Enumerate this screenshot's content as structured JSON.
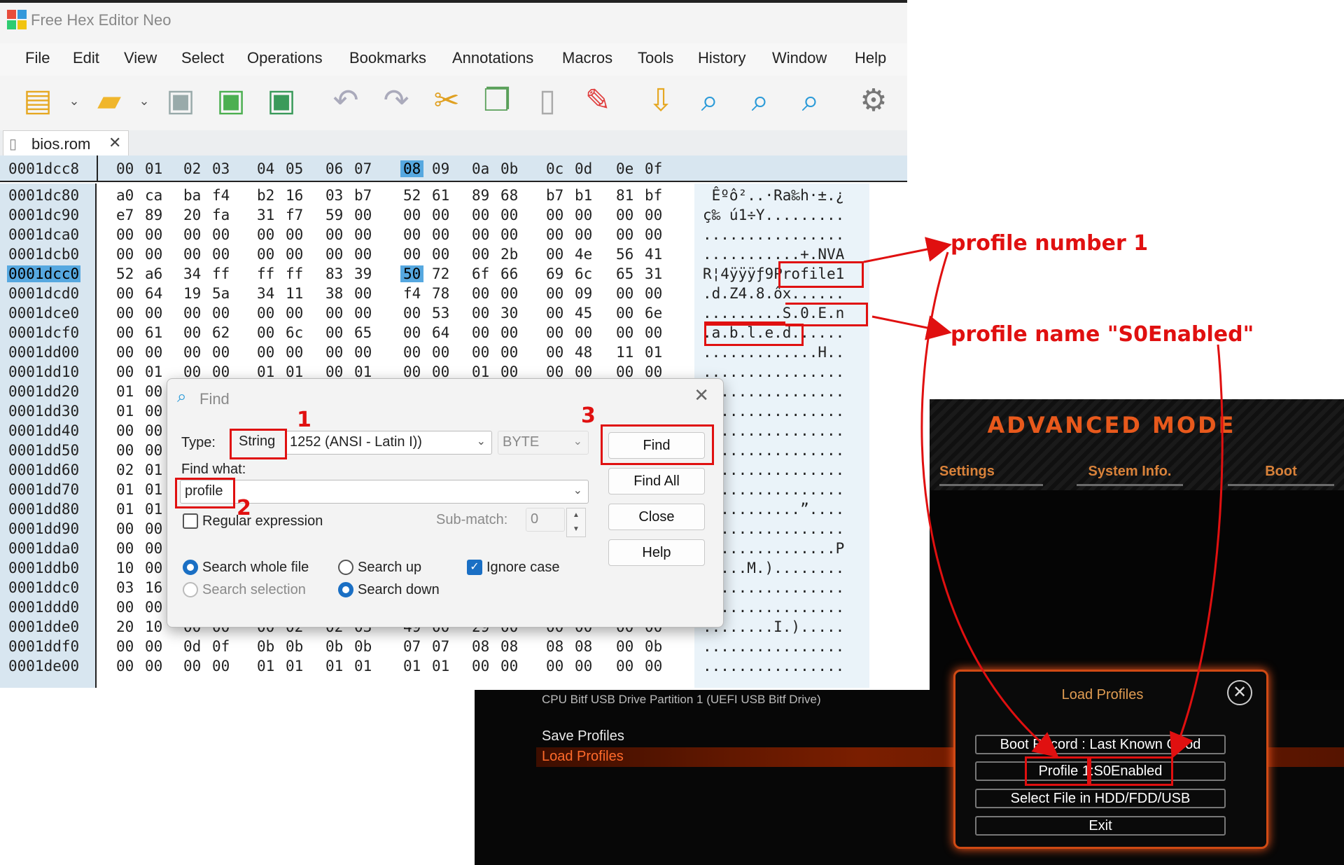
{
  "app": {
    "title": "Free Hex Editor Neo"
  },
  "menu": [
    "File",
    "Edit",
    "View",
    "Select",
    "Operations",
    "Bookmarks",
    "Annotations",
    "Macros",
    "Tools",
    "History",
    "Window",
    "Help"
  ],
  "toolbar_icons": [
    "new-file-icon",
    "open-folder-icon",
    "save-icon",
    "save-as-icon",
    "save-all-icon",
    "undo-icon",
    "redo-icon",
    "cut-icon",
    "copy-icon",
    "paste-icon",
    "modify-icon",
    "import-icon",
    "find-icon",
    "find-previous-icon",
    "find-next-icon",
    "settings-icon"
  ],
  "file_tab": {
    "name": "bios.rom",
    "close": "✕"
  },
  "hex": {
    "current_offset": "0001dcc8",
    "columns": [
      "00",
      "01",
      "02",
      "03",
      "04",
      "05",
      "06",
      "07",
      "08",
      "09",
      "0a",
      "0b",
      "0c",
      "0d",
      "0e",
      "0f"
    ],
    "rows": [
      {
        "addr": "0001dc80",
        "bytes": [
          "a0",
          "ca",
          "ba",
          "f4",
          "b2",
          "16",
          "03",
          "b7",
          "52",
          "61",
          "89",
          "68",
          "b7",
          "b1",
          "81",
          "bf"
        ],
        "ascii": " Êºô²..·Ra‰h·±.¿"
      },
      {
        "addr": "0001dc90",
        "bytes": [
          "e7",
          "89",
          "20",
          "fa",
          "31",
          "f7",
          "59",
          "00",
          "00",
          "00",
          "00",
          "00",
          "00",
          "00",
          "00",
          "00"
        ],
        "ascii": "ç‰ ú1÷Y........."
      },
      {
        "addr": "0001dca0",
        "bytes": [
          "00",
          "00",
          "00",
          "00",
          "00",
          "00",
          "00",
          "00",
          "00",
          "00",
          "00",
          "00",
          "00",
          "00",
          "00",
          "00"
        ],
        "ascii": "................"
      },
      {
        "addr": "0001dcb0",
        "bytes": [
          "00",
          "00",
          "00",
          "00",
          "00",
          "00",
          "00",
          "00",
          "00",
          "00",
          "00",
          "2b",
          "00",
          "4e",
          "56",
          "41"
        ],
        "ascii": "...........+.NVA"
      },
      {
        "addr": "0001dcc0",
        "bytes": [
          "52",
          "a6",
          "34",
          "ff",
          "ff",
          "ff",
          "83",
          "39",
          "50",
          "72",
          "6f",
          "66",
          "69",
          "6c",
          "65",
          "31"
        ],
        "ascii": "R¦4ÿÿÿƒ9Profile1"
      },
      {
        "addr": "0001dcd0",
        "bytes": [
          "00",
          "64",
          "19",
          "5a",
          "34",
          "11",
          "38",
          "00",
          "f4",
          "78",
          "00",
          "00",
          "00",
          "09",
          "00",
          "00"
        ],
        "ascii": ".d.Z4.8.ôx......"
      },
      {
        "addr": "0001dce0",
        "bytes": [
          "00",
          "00",
          "00",
          "00",
          "00",
          "00",
          "00",
          "00",
          "00",
          "53",
          "00",
          "30",
          "00",
          "45",
          "00",
          "6e"
        ],
        "ascii": ".........S.0.E.n"
      },
      {
        "addr": "0001dcf0",
        "bytes": [
          "00",
          "61",
          "00",
          "62",
          "00",
          "6c",
          "00",
          "65",
          "00",
          "64",
          "00",
          "00",
          "00",
          "00",
          "00",
          "00"
        ],
        "ascii": ".a.b.l.e.d......"
      },
      {
        "addr": "0001dd00",
        "bytes": [
          "00",
          "00",
          "00",
          "00",
          "00",
          "00",
          "00",
          "00",
          "00",
          "00",
          "00",
          "00",
          "00",
          "48",
          "11",
          "01"
        ],
        "ascii": ".............H.."
      },
      {
        "addr": "0001dd10",
        "bytes": [
          "00",
          "01",
          "00",
          "00",
          "01",
          "01",
          "00",
          "01",
          "00",
          "00",
          "01",
          "00",
          "00",
          "00",
          "00",
          "00"
        ],
        "ascii": "................"
      },
      {
        "addr": "0001dd20",
        "bytes": [
          "01",
          "00"
        ],
        "ascii": "................"
      },
      {
        "addr": "0001dd30",
        "bytes": [
          "01",
          "00"
        ],
        "ascii": "................"
      },
      {
        "addr": "0001dd40",
        "bytes": [
          "00",
          "00"
        ],
        "ascii": "................"
      },
      {
        "addr": "0001dd50",
        "bytes": [
          "00",
          "00"
        ],
        "ascii": "................"
      },
      {
        "addr": "0001dd60",
        "bytes": [
          "02",
          "01"
        ],
        "ascii": "................"
      },
      {
        "addr": "0001dd70",
        "bytes": [
          "01",
          "01"
        ],
        "ascii": "................"
      },
      {
        "addr": "0001dd80",
        "bytes": [
          "01",
          "01"
        ],
        "ascii": "...........”...."
      },
      {
        "addr": "0001dd90",
        "bytes": [
          "00",
          "00"
        ],
        "ascii": "................"
      },
      {
        "addr": "0001dda0",
        "bytes": [
          "00",
          "00"
        ],
        "ascii": "...............P"
      },
      {
        "addr": "0001ddb0",
        "bytes": [
          "10",
          "00"
        ],
        "ascii": ".....M.)........"
      },
      {
        "addr": "0001ddc0",
        "bytes": [
          "03",
          "16"
        ],
        "ascii": "................"
      },
      {
        "addr": "0001ddd0",
        "bytes": [
          "00",
          "00"
        ],
        "ascii": "................"
      },
      {
        "addr": "0001dde0",
        "bytes": [
          "20",
          "10",
          "00",
          "00",
          "00",
          "02",
          "02",
          "03",
          "49",
          "00",
          "29",
          "00",
          "00",
          "00",
          "00",
          "00"
        ],
        "ascii": "........I.)....."
      },
      {
        "addr": "0001ddf0",
        "bytes": [
          "00",
          "00",
          "0d",
          "0f",
          "0b",
          "0b",
          "0b",
          "0b",
          "07",
          "07",
          "08",
          "08",
          "08",
          "08",
          "00",
          "0b"
        ],
        "ascii": "................"
      },
      {
        "addr": "0001de00",
        "bytes": [
          "00",
          "00",
          "00",
          "00",
          "01",
          "01",
          "01",
          "01",
          "01",
          "01",
          "00",
          "00",
          "00",
          "00",
          "00",
          "00"
        ],
        "ascii": "................"
      }
    ]
  },
  "find": {
    "title": "Find",
    "type_label": "Type:",
    "type_value": "String",
    "encoding": "1252  (ANSI - Latin I))",
    "width": "BYTE",
    "find_what_label": "Find what:",
    "find_what_value": "profile",
    "regex_label": "Regular expression",
    "submatch_label": "Sub-match:",
    "submatch_value": "0",
    "search_whole_file": "Search whole file",
    "search_selection": "Search selection",
    "search_up": "Search up",
    "search_down": "Search down",
    "ignore_case": "Ignore case",
    "btn_find": "Find",
    "btn_find_all": "Find All",
    "btn_close": "Close",
    "btn_help": "Help"
  },
  "annotations": {
    "n1": "1",
    "n2": "2",
    "n3": "3",
    "profile_number": "profile number 1",
    "profile_name": "profile name \"S0Enabled\""
  },
  "bios": {
    "title": "ADVANCED MODE",
    "tabs": [
      "Settings",
      "System Info.",
      "Boot"
    ],
    "cut_text": "CPU Bitf USB Drive Partition 1 (UEFI USB Bitf Drive)",
    "save_profiles": "Save Profiles",
    "load_profiles": "Load Profiles",
    "popup_title": "Load Profiles",
    "opt_boot_record": "Boot Record : Last Known Good",
    "opt_profile_num": "Profile 1",
    "opt_profile_name": "S0Enabled",
    "opt_select_file": "Select File in HDD/FDD/USB",
    "opt_exit": "Exit",
    "colors": {
      "accent": "#e8591c",
      "annotation_red": "#e01010",
      "selection_blue": "#56a8e0"
    }
  }
}
